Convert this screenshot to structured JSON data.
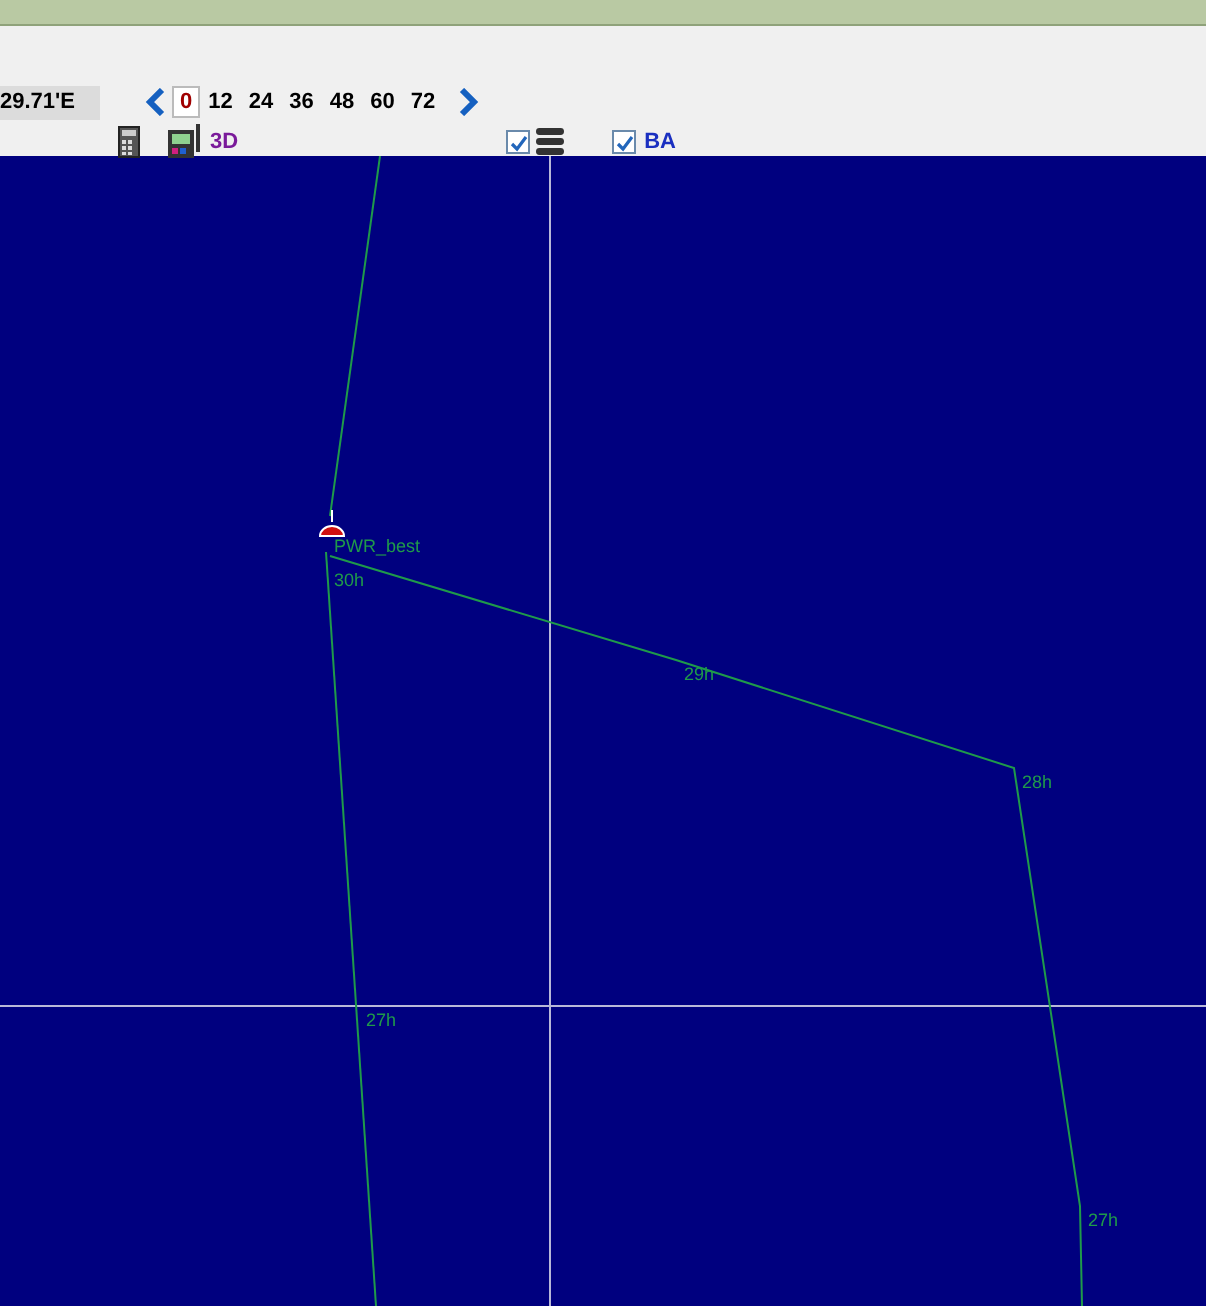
{
  "toolbar": {
    "coordinate": "29.71'E",
    "hours": [
      {
        "label": "0",
        "selected": true
      },
      {
        "label": "12",
        "selected": false
      },
      {
        "label": "24",
        "selected": false
      },
      {
        "label": "36",
        "selected": false
      },
      {
        "label": "48",
        "selected": false
      },
      {
        "label": "60",
        "selected": false
      },
      {
        "label": "72",
        "selected": false
      }
    ],
    "view_3d": "3D",
    "layers_checked": true,
    "ba": {
      "label": "BA",
      "checked": true
    }
  },
  "map": {
    "boat_label": "PWR_best",
    "waypoints": [
      {
        "label": "30h"
      },
      {
        "label": "29h"
      },
      {
        "label": "28h"
      },
      {
        "label": "27h"
      },
      {
        "label": "27h"
      }
    ]
  }
}
